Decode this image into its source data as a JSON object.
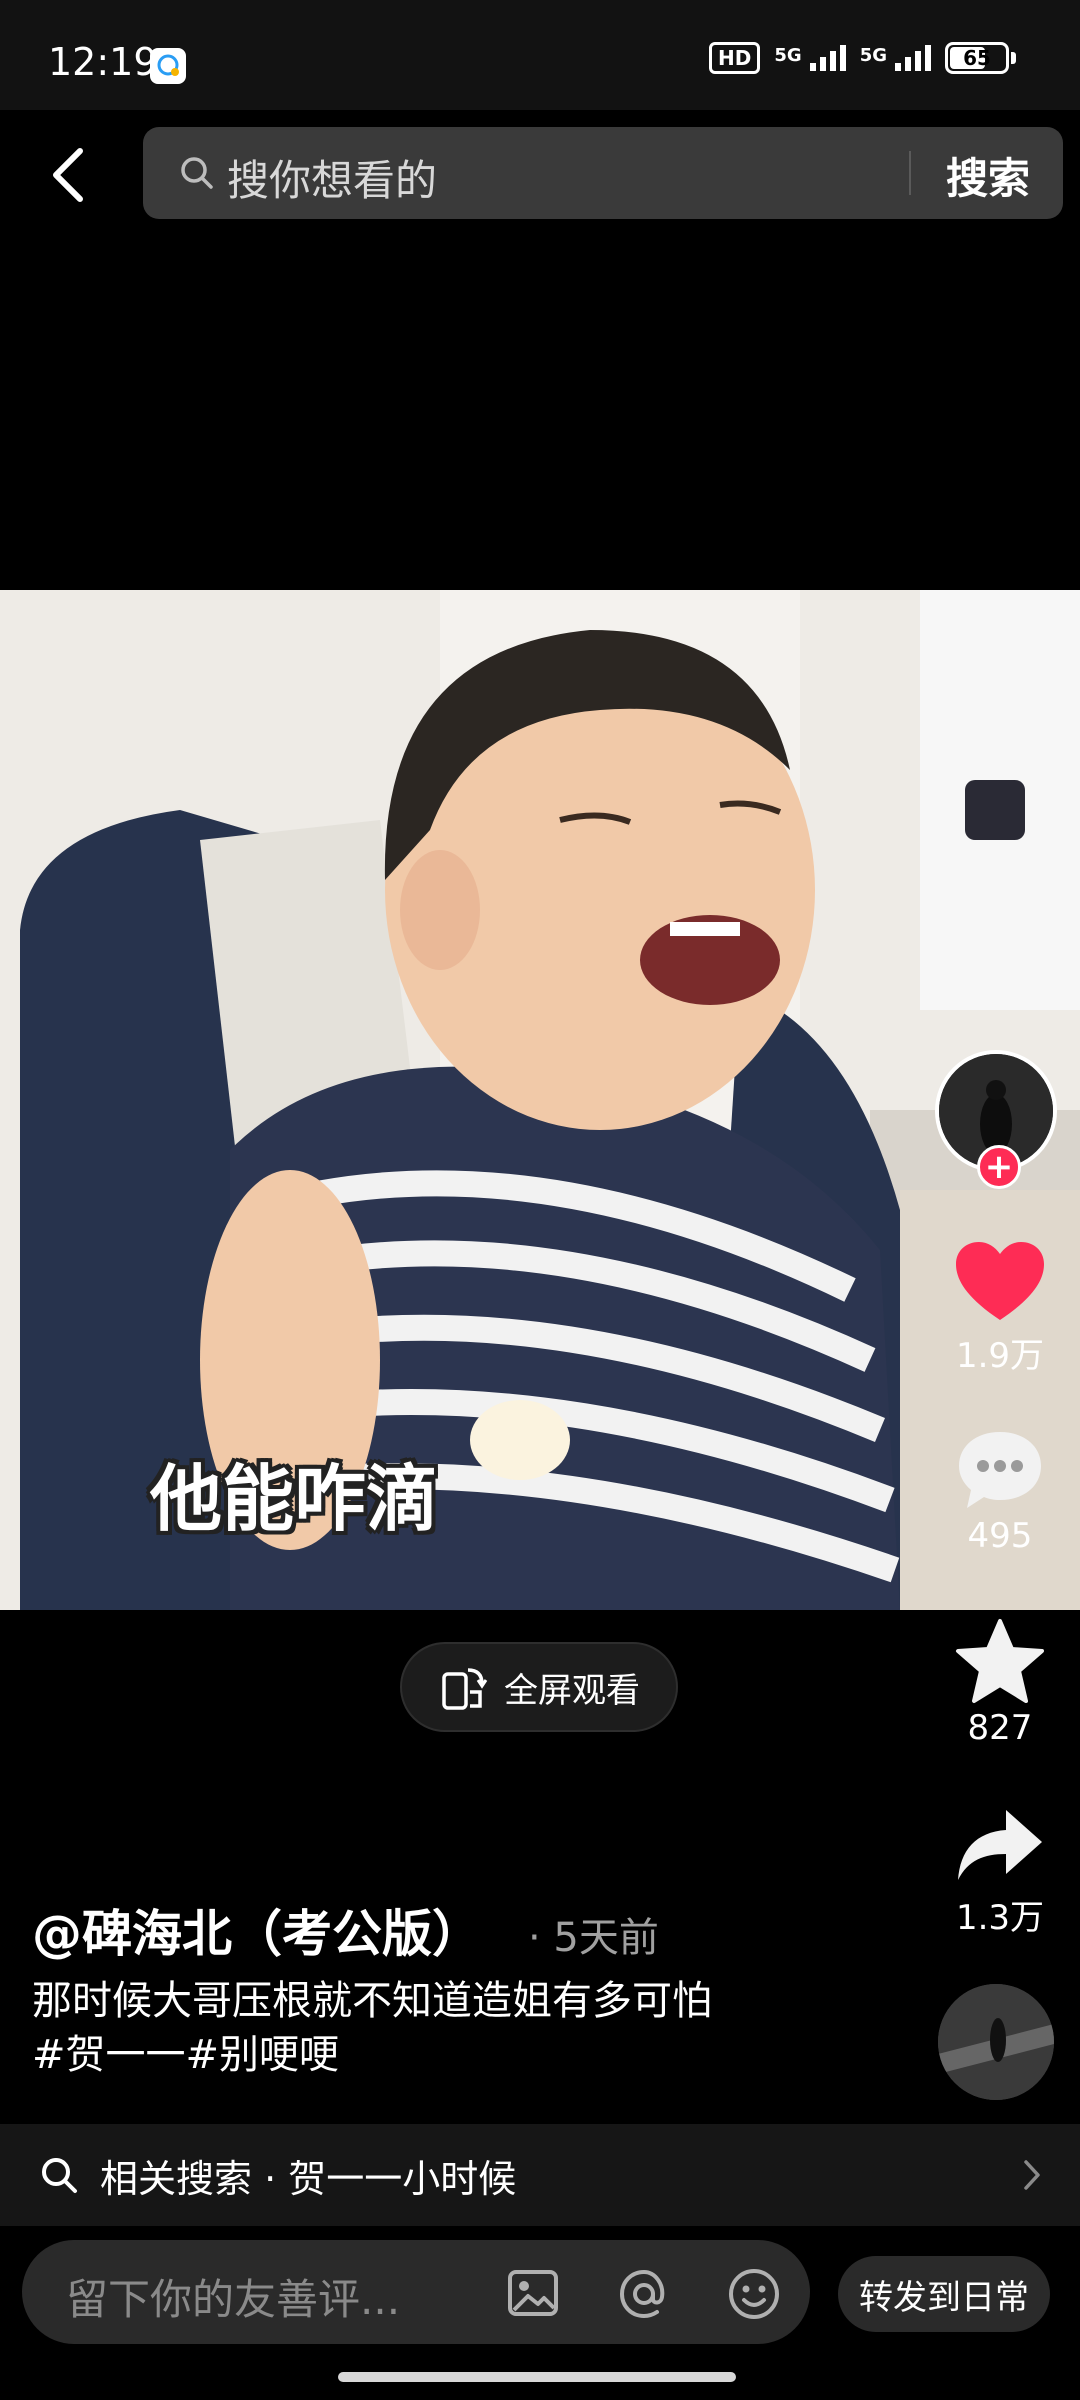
{
  "status_bar": {
    "time": "12:19",
    "hd_label": "HD",
    "signal_1": "5G",
    "signal_2": "5G",
    "battery": "65",
    "battery_level": 0.65
  },
  "header": {
    "search_placeholder": "搜你想看的",
    "search_button": "搜索"
  },
  "video": {
    "subtitle": "他能咋滴",
    "fullscreen_label": "全屏观看"
  },
  "actions": {
    "likes": "1.9万",
    "comments": "495",
    "favorites": "827",
    "shares": "1.3万"
  },
  "post": {
    "author": "@碑海北（考公版）",
    "time": "· 5天前",
    "caption_line1": "那时候大哥压根就不知道造姐有多可怕",
    "caption_line2": "#贺一一#别哽哽"
  },
  "related": {
    "text": "相关搜索 · 贺一一小时候"
  },
  "comment_bar": {
    "placeholder": "留下你的友善评...",
    "repost_label": "转发到日常"
  },
  "colors": {
    "like": "#fe2c55",
    "background": "#000000",
    "search_bg": "#3a3a3a"
  }
}
